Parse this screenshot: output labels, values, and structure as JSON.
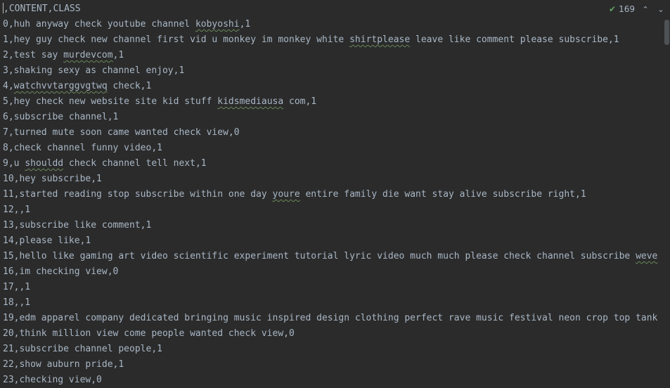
{
  "editor": {
    "header": ",CONTENT,CLASS",
    "lines": [
      [
        {
          "t": "0,huh anyway check youtube channel "
        },
        {
          "t": "kobyoshi",
          "s": 1
        },
        {
          "t": ",1"
        }
      ],
      [
        {
          "t": "1,hey guy check new channel first vid u monkey im monkey white "
        },
        {
          "t": "shirtplease",
          "s": 1
        },
        {
          "t": " leave like comment please subscribe,1"
        }
      ],
      [
        {
          "t": "2,test say "
        },
        {
          "t": "murdevcom",
          "s": 1
        },
        {
          "t": ",1"
        }
      ],
      [
        {
          "t": "3,shaking sexy as channel enjoy,1"
        }
      ],
      [
        {
          "t": "4,"
        },
        {
          "t": "watchvvtarggvgtwq",
          "s": 1
        },
        {
          "t": " check,1"
        }
      ],
      [
        {
          "t": "5,hey check new website site kid stuff "
        },
        {
          "t": "kidsmediausa",
          "s": 1
        },
        {
          "t": " com,1"
        }
      ],
      [
        {
          "t": "6,subscribe channel,1"
        }
      ],
      [
        {
          "t": "7,turned mute soon came wanted check view,0"
        }
      ],
      [
        {
          "t": "8,check channel funny video,1"
        }
      ],
      [
        {
          "t": "9,u "
        },
        {
          "t": "shouldd",
          "s": 1
        },
        {
          "t": " check channel tell next,1"
        }
      ],
      [
        {
          "t": "10,hey subscribe,1"
        }
      ],
      [
        {
          "t": "11,started reading stop subscribe within one day "
        },
        {
          "t": "youre",
          "s": 1
        },
        {
          "t": " entire family die want stay alive subscribe right,1"
        }
      ],
      [
        {
          "t": "12,,1"
        }
      ],
      [
        {
          "t": "13,subscribe like comment,1"
        }
      ],
      [
        {
          "t": "14,please like,1"
        }
      ],
      [
        {
          "t": "15,hello like gaming art video scientific experiment tutorial lyric video much much please check channel subscribe "
        },
        {
          "t": "weve",
          "s": 1
        }
      ],
      [
        {
          "t": "16,im checking view,0"
        }
      ],
      [
        {
          "t": "17,,1"
        }
      ],
      [
        {
          "t": "18,,1"
        }
      ],
      [
        {
          "t": "19,edm apparel company dedicated bringing music inspired design clothing perfect rave music festival neon crop top tank"
        }
      ],
      [
        {
          "t": "20,think million view come people wanted check view,0"
        }
      ],
      [
        {
          "t": "21,subscribe channel people,1"
        }
      ],
      [
        {
          "t": "22,show auburn pride,1"
        }
      ],
      [
        {
          "t": "23,checking view,0"
        }
      ]
    ]
  },
  "inspection": {
    "count": "169",
    "icon": "check-icon",
    "prev_icon": "chevron-up-icon",
    "next_icon": "chevron-down-icon",
    "prev_glyph": "⌃",
    "next_glyph": "⌄",
    "check_glyph": "✔"
  },
  "colors": {
    "background": "#2b2b2b",
    "text": "#a9b7c6",
    "typo": "#6a8759",
    "check": "#5fa35f"
  }
}
